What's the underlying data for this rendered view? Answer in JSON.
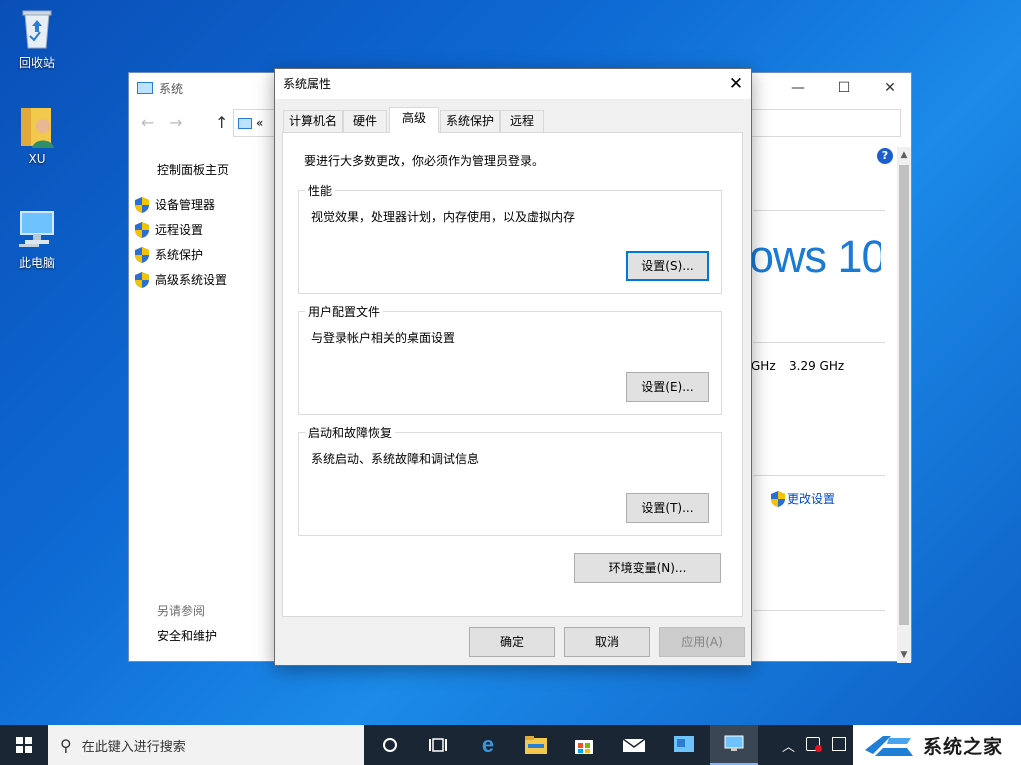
{
  "desktop": {
    "icons": [
      {
        "label": "回收站"
      },
      {
        "label": "XU"
      },
      {
        "label": "此电脑"
      }
    ]
  },
  "system_window": {
    "title": "系统",
    "address_prefix": "«",
    "sidebar": {
      "home": "控制面板主页",
      "links": [
        "设备管理器",
        "远程设置",
        "系统保护",
        "高级系统设置"
      ],
      "see_also_heading": "另请参阅",
      "see_also": [
        "安全和维护"
      ]
    },
    "brand_text": "ows 10",
    "cpu_speed_partial": "GHz",
    "cpu_speed": "3.29 GHz",
    "change_settings": "更改设置",
    "help_glyph": "?"
  },
  "dialog": {
    "title": "系统属性",
    "tabs": [
      "计算机名",
      "硬件",
      "高级",
      "系统保护",
      "远程"
    ],
    "active_tab": "高级",
    "admin_note": "要进行大多数更改，你必须作为管理员登录。",
    "groups": [
      {
        "legend": "性能",
        "desc": "视觉效果，处理器计划，内存使用，以及虚拟内存",
        "button": "设置(S)..."
      },
      {
        "legend": "用户配置文件",
        "desc": "与登录帐户相关的桌面设置",
        "button": "设置(E)..."
      },
      {
        "legend": "启动和故障恢复",
        "desc": "系统启动、系统故障和调试信息",
        "button": "设置(T)..."
      }
    ],
    "env_button": "环境变量(N)...",
    "ok": "确定",
    "cancel": "取消",
    "apply": "应用(A)"
  },
  "taskbar": {
    "search_placeholder": "在此键入进行搜索",
    "watermark": "系统之家"
  },
  "colors": {
    "accent": "#0078d7",
    "taskbar": "#1a2633",
    "desktop": "#0e6ad4"
  }
}
